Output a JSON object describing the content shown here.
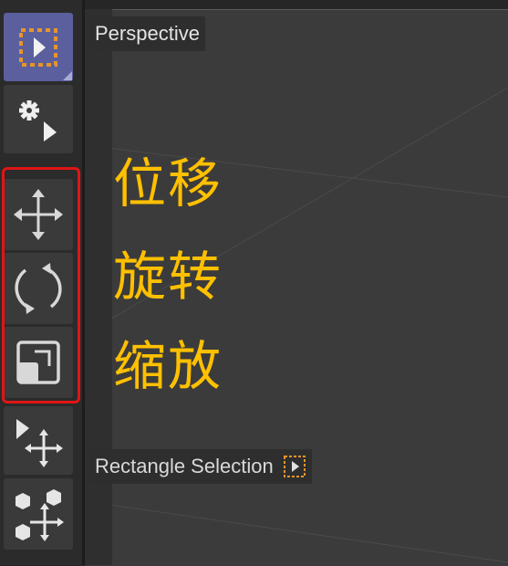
{
  "viewport": {
    "label": "Perspective",
    "selection_hint": "Rectangle Selection"
  },
  "toolbar": {
    "tools": [
      {
        "name": "rectangle-selection",
        "icon": "rectangle-select-icon",
        "active": true
      },
      {
        "name": "live-selection",
        "icon": "gear-cursor-icon",
        "active": false
      },
      {
        "name": "move",
        "icon": "move-arrows-icon",
        "active": false
      },
      {
        "name": "rotate",
        "icon": "rotate-arrows-icon",
        "active": false
      },
      {
        "name": "scale",
        "icon": "scale-icon",
        "active": false
      },
      {
        "name": "transform",
        "icon": "cursor-move-icon",
        "active": false
      },
      {
        "name": "placement",
        "icon": "cubes-move-icon",
        "active": false
      }
    ]
  },
  "annotations": {
    "move": "位移",
    "rotate": "旋转",
    "scale": "缩放"
  },
  "colors": {
    "accent_active": "#5b5f9e",
    "annotation_text": "#ffc000",
    "highlight_box": "#e01515",
    "selection_dashes": "#e8952a"
  }
}
